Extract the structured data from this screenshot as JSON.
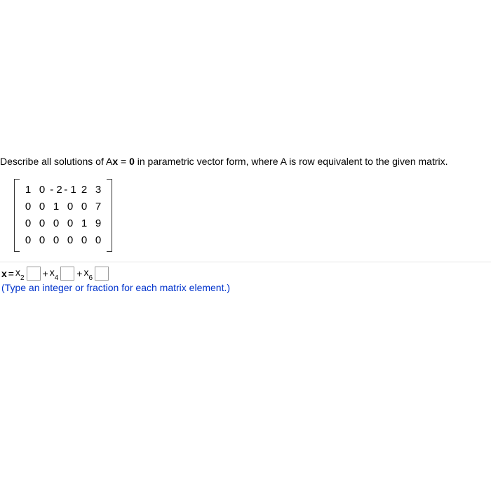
{
  "question": {
    "prefix": "Describe all solutions of A",
    "ax_bold": "x",
    "middle": " = ",
    "zero_bold": "0",
    "suffix": " in parametric vector form, where A is row equivalent to the given matrix."
  },
  "matrix": {
    "rows": [
      [
        "1",
        "0",
        "- 2",
        "- 1",
        "2",
        "3"
      ],
      [
        "0",
        "0",
        "1",
        "0",
        "0",
        "7"
      ],
      [
        "0",
        "0",
        "0",
        "0",
        "1",
        "9"
      ],
      [
        "0",
        "0",
        "0",
        "0",
        "0",
        "0"
      ]
    ]
  },
  "answer": {
    "lhs_bold": "x",
    "eq": " = ",
    "t1": "x",
    "s1": "2",
    "plus1": " + ",
    "t2": "x",
    "s2": "4",
    "plus2": " + ",
    "t3": "x",
    "s3": "6"
  },
  "hint": "(Type an integer or fraction for each matrix element.)"
}
